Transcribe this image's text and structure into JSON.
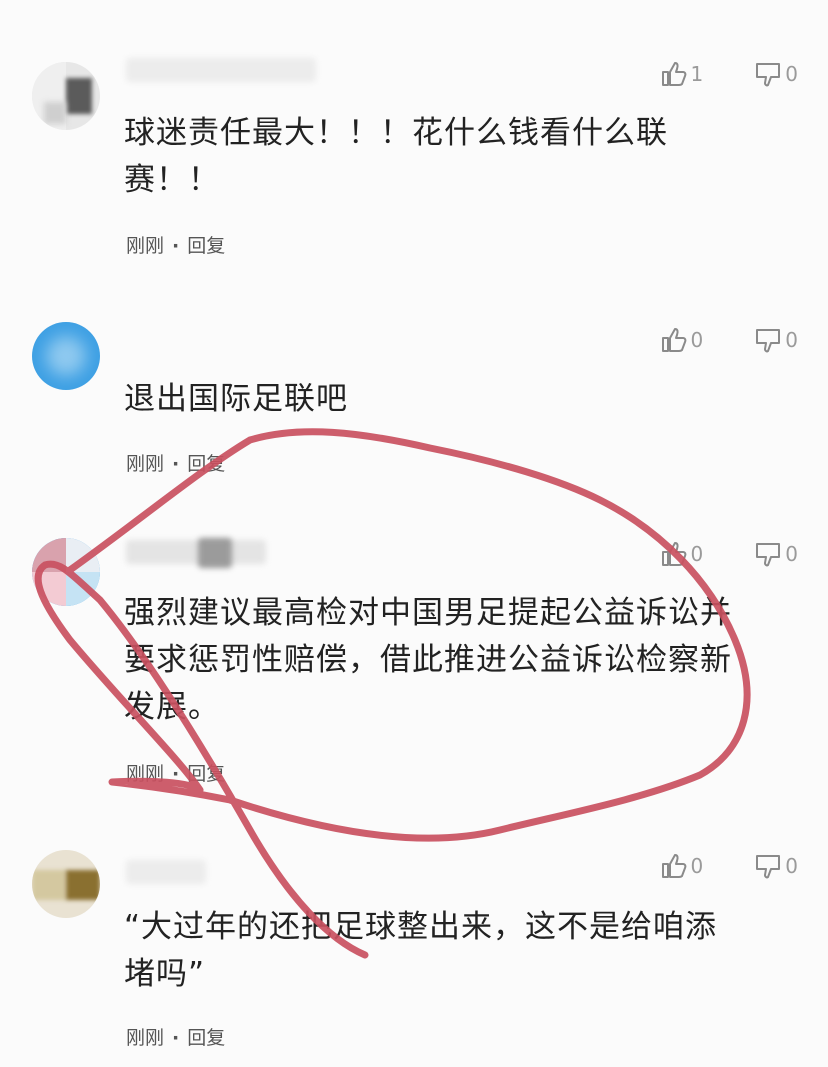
{
  "comments": [
    {
      "likes": "1",
      "dislikes": "0",
      "text": "球迷责任最大！！！花什么钱看什么联\n赛！！",
      "time": "刚刚",
      "reply": "回复"
    },
    {
      "likes": "0",
      "dislikes": "0",
      "text": "退出国际足联吧",
      "time": "刚刚",
      "reply": "回复"
    },
    {
      "likes": "0",
      "dislikes": "0",
      "text": "强烈建议最高检对中国男足提起公益诉讼并\n要求惩罚性赔偿，借此推进公益诉讼检察新\n发展。",
      "time": "刚刚",
      "reply": "回复"
    },
    {
      "likes": "0",
      "dislikes": "0",
      "text": "“大过年的还把足球整出来，这不是给咱添\n堵吗”",
      "time": "刚刚",
      "reply": "回复"
    }
  ],
  "icons": {
    "like": "thumb-up-icon",
    "dislike": "thumb-down-icon"
  },
  "colors": {
    "marker": "#c9505f",
    "avatar_blue": "#3ea0e4"
  }
}
